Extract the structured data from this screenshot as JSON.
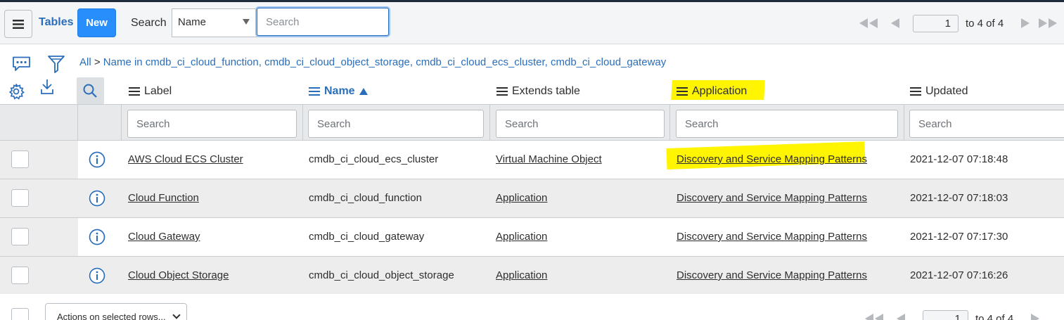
{
  "header": {
    "title": "Tables",
    "new_label": "New",
    "search_label": "Search",
    "search_field_selected": "Name",
    "search_placeholder": "Search"
  },
  "pager": {
    "current_page": "1",
    "range_text": "to 4 of 4"
  },
  "breadcrumb": {
    "all": "All",
    "separator": ">",
    "condition": "Name in cmdb_ci_cloud_function, cmdb_ci_cloud_object_storage, cmdb_ci_cloud_ecs_cluster, cmdb_ci_cloud_gateway"
  },
  "columns": {
    "label": "Label",
    "name": "Name",
    "extends": "Extends table",
    "application": "Application",
    "updated": "Updated"
  },
  "filter_placeholder": "Search",
  "rows": [
    {
      "label": "AWS Cloud ECS Cluster",
      "name": "cmdb_ci_cloud_ecs_cluster",
      "extends": "Virtual Machine Object",
      "application": "Discovery and Service Mapping Patterns",
      "updated": "2021-12-07 07:18:48"
    },
    {
      "label": "Cloud Function",
      "name": "cmdb_ci_cloud_function",
      "extends": "Application",
      "application": "Discovery and Service Mapping Patterns",
      "updated": "2021-12-07 07:18:03"
    },
    {
      "label": "Cloud Gateway",
      "name": "cmdb_ci_cloud_gateway",
      "extends": "Application",
      "application": "Discovery and Service Mapping Patterns",
      "updated": "2021-12-07 07:17:30"
    },
    {
      "label": "Cloud Object Storage",
      "name": "cmdb_ci_cloud_object_storage",
      "extends": "Application",
      "application": "Discovery and Service Mapping Patterns",
      "updated": "2021-12-07 07:16:26"
    }
  ],
  "footer": {
    "actions_label": "Actions on selected rows...",
    "current_page": "1",
    "range_text": "to 4 of 4"
  },
  "icons": {
    "menu": "hamburger-icon",
    "chat": "chat-icon",
    "filter": "funnel-icon",
    "settings": "gear-icon",
    "download": "download-icon",
    "search": "search-icon",
    "info": "info-icon",
    "first": "first-page-icon",
    "prev": "prev-page-icon",
    "next": "next-page-icon",
    "last": "last-page-icon"
  },
  "colors": {
    "accent": "#2a6ebb",
    "button": "#278efc",
    "highlight": "#fff500"
  }
}
